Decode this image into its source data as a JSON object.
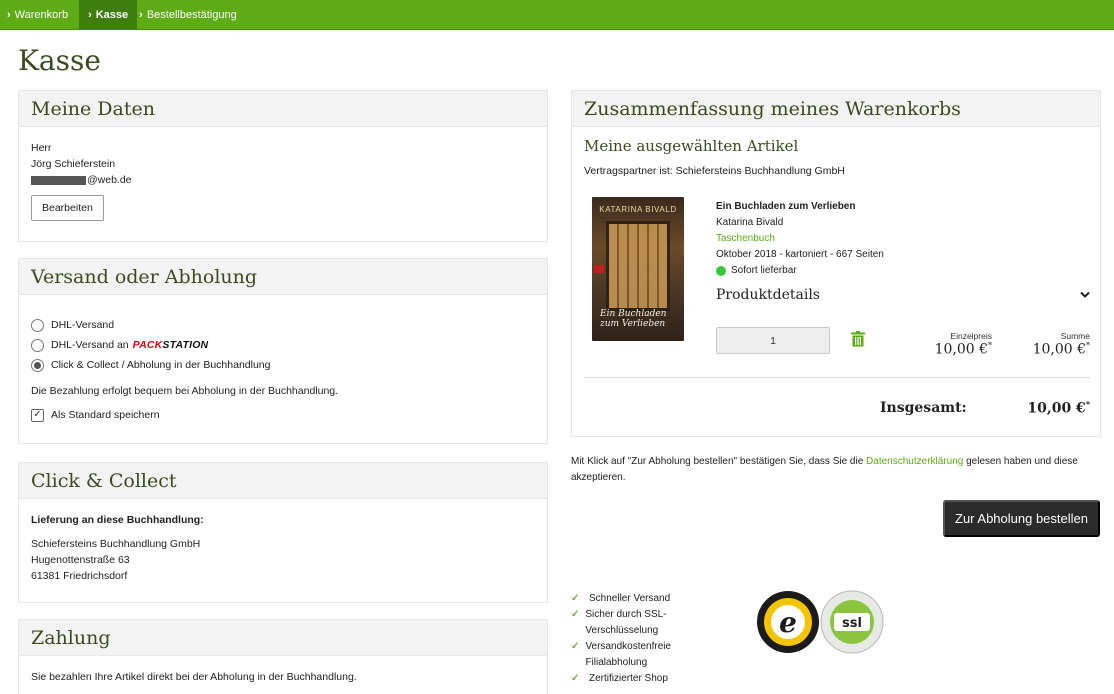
{
  "breadcrumb": {
    "steps": [
      {
        "label": "Warenkorb"
      },
      {
        "label": "Kasse"
      },
      {
        "label": "Bestellbestätigung"
      }
    ]
  },
  "page": {
    "title": "Kasse"
  },
  "meine_daten": {
    "title": "Meine Daten",
    "salutation": "Herr",
    "name": "Jörg Schieferstein",
    "email_suffix": "@web.de",
    "edit_label": "Bearbeiten"
  },
  "versand": {
    "title": "Versand oder Abholung",
    "options": [
      {
        "label": "DHL-Versand"
      },
      {
        "label": "DHL-Versand an"
      },
      {
        "label": "Click & Collect / Abholung in der Buchhandlung"
      }
    ],
    "packstation_part1": "PACK",
    "packstation_part2": "STATION",
    "info": "Die Bezahlung erfolgt bequem bei Abholung in der Buchhandlung.",
    "save_default_label": "Als Standard speichern"
  },
  "click_collect": {
    "title": "Click & Collect",
    "delivery_heading": "Lieferung an diese Buchhandlung:",
    "store_name": "Schiefersteins Buchhandlung GmbH",
    "street": "Hugenottenstraße 63",
    "city": "61381 Friedrichsdorf"
  },
  "zahlung": {
    "title": "Zahlung",
    "text": "Sie bezahlen Ihre Artikel direkt bei der Abholung in der Buchhandlung."
  },
  "summary": {
    "title": "Zusammenfassung meines Warenkorbs",
    "subtitle": "Meine ausgewählten Artikel",
    "partner": "Vertragspartner ist: Schiefersteins Buchhandlung GmbH",
    "item": {
      "title": "Ein Buchladen zum Verlieben",
      "author": "Katarina Bivald",
      "format": "Taschenbuch",
      "details": "Oktober 2018 - kartoniert - 667 Seiten",
      "availability": "Sofort lieferbar",
      "product_details_label": "Produktdetails",
      "cover_author": "KATARINA BIVALD",
      "cover_script": "Ein Buchladen zum Verlieben",
      "quantity": "1",
      "unit_price_label": "Einzelpreis",
      "unit_price": "10,00 €",
      "sum_label": "Summe",
      "sum": "10,00 €"
    },
    "total_label": "Insgesamt:",
    "total": "10,00 €",
    "asterisk": "*"
  },
  "consent": {
    "before": "Mit Klick auf \"Zur Abholung bestellen\" bestätigen Sie, dass Sie die ",
    "link": "Datenschutzerklärung",
    "after": " gelesen haben und diese akzeptieren."
  },
  "order_button_label": "Zur Abholung bestellen",
  "features": [
    {
      "label": "Schneller Versand"
    },
    {
      "label": "Sicher durch SSL-Verschlüsselung"
    },
    {
      "label": "Versandkostenfreie Filialabholung"
    },
    {
      "label": "Zertifizierter Shop"
    }
  ],
  "seals": {
    "trusted_letter": "e",
    "ssl_label": "ssl"
  },
  "colors": {
    "brand_green": "#5eab15",
    "dark_button": "#2b2b2b",
    "heading": "#3c4a1e",
    "available_dot": "#39c83a"
  }
}
